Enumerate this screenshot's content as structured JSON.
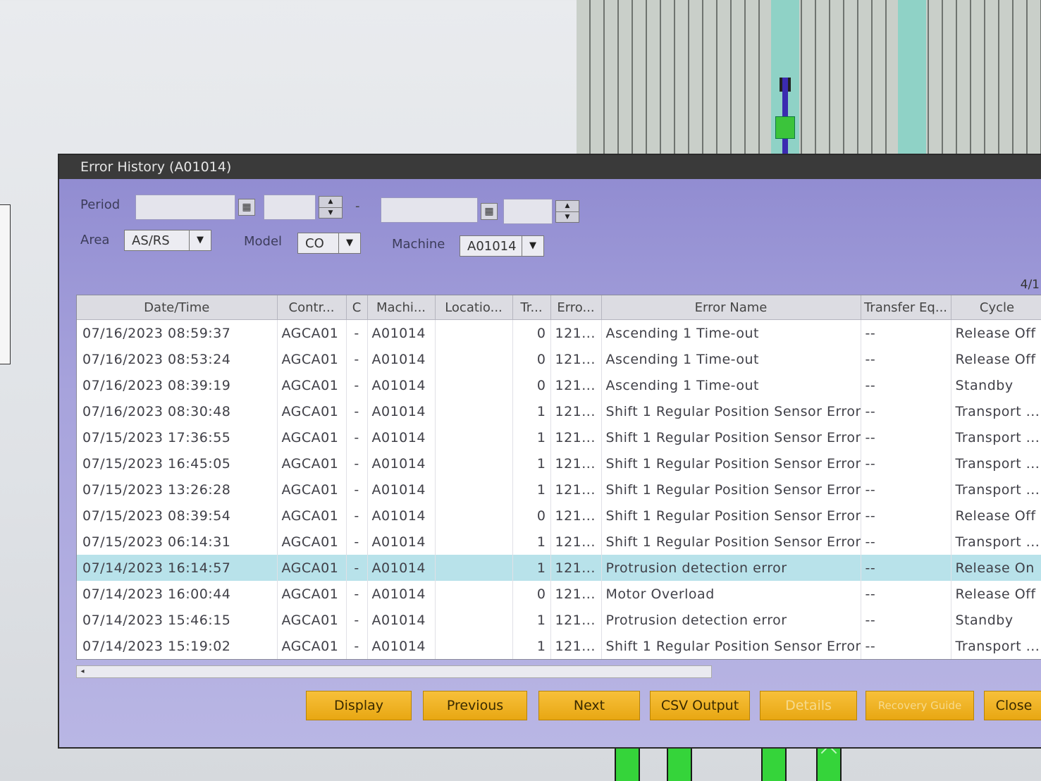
{
  "window": {
    "title": "Error History (A01014)"
  },
  "filters": {
    "period_label": "Period",
    "period_separator": "-",
    "area_label": "Area",
    "area_value": "AS/RS",
    "model_label": "Model",
    "model_value": "CO",
    "machine_label": "Machine",
    "machine_value": "A01014"
  },
  "page_indicator": "4/1",
  "table": {
    "columns": [
      "Date/Time",
      "Contr...",
      "C",
      "Machi...",
      "Locatio...",
      "Tr...",
      "Erro...",
      "Error Name",
      "Transfer Eq...",
      "Cycle"
    ],
    "rows": [
      [
        "07/16/2023 08:59:37",
        "AGCA01",
        "-",
        "A01014",
        "",
        "0",
        "121...",
        "Ascending 1 Time-out",
        "--",
        "Release Off"
      ],
      [
        "07/16/2023 08:53:24",
        "AGCA01",
        "-",
        "A01014",
        "",
        "0",
        "121...",
        "Ascending 1 Time-out",
        "--",
        "Release Off"
      ],
      [
        "07/16/2023 08:39:19",
        "AGCA01",
        "-",
        "A01014",
        "",
        "0",
        "121...",
        "Ascending 1 Time-out",
        "--",
        "Standby"
      ],
      [
        "07/16/2023 08:30:48",
        "AGCA01",
        "-",
        "A01014",
        "",
        "1",
        "121...",
        "Shift 1 Regular Position Sensor Error",
        "--",
        "Transport ..."
      ],
      [
        "07/15/2023 17:36:55",
        "AGCA01",
        "-",
        "A01014",
        "",
        "1",
        "121...",
        "Shift 1 Regular Position Sensor Error",
        "--",
        "Transport ..."
      ],
      [
        "07/15/2023 16:45:05",
        "AGCA01",
        "-",
        "A01014",
        "",
        "1",
        "121...",
        "Shift 1 Regular Position Sensor Error",
        "--",
        "Transport ..."
      ],
      [
        "07/15/2023 13:26:28",
        "AGCA01",
        "-",
        "A01014",
        "",
        "1",
        "121...",
        "Shift 1 Regular Position Sensor Error",
        "--",
        "Transport ..."
      ],
      [
        "07/15/2023 08:39:54",
        "AGCA01",
        "-",
        "A01014",
        "",
        "0",
        "121...",
        "Shift 1 Regular Position Sensor Error",
        "--",
        "Release Off"
      ],
      [
        "07/15/2023 06:14:31",
        "AGCA01",
        "-",
        "A01014",
        "",
        "1",
        "121...",
        "Shift 1 Regular Position Sensor Error",
        "--",
        "Transport ..."
      ],
      [
        "07/14/2023 16:14:57",
        "AGCA01",
        "-",
        "A01014",
        "",
        "1",
        "121...",
        "Protrusion detection error",
        "--",
        "Release On"
      ],
      [
        "07/14/2023 16:00:44",
        "AGCA01",
        "-",
        "A01014",
        "",
        "0",
        "121...",
        "Motor Overload",
        "--",
        "Release Off"
      ],
      [
        "07/14/2023 15:46:15",
        "AGCA01",
        "-",
        "A01014",
        "",
        "1",
        "121...",
        "Protrusion detection error",
        "--",
        "Standby"
      ],
      [
        "07/14/2023 15:19:02",
        "AGCA01",
        "-",
        "A01014",
        "",
        "1",
        "121...",
        "Shift 1 Regular Position Sensor Error",
        "--",
        "Transport ..."
      ]
    ],
    "selected_row": 9
  },
  "buttons": {
    "display": "Display",
    "previous": "Previous",
    "next": "Next",
    "csv_output": "CSV Output",
    "details": "Details",
    "recovery_guide": "Recovery Guide",
    "close": "Close"
  },
  "icons": {
    "calendar": "calendar-icon",
    "spin_up": "▲",
    "spin_down": "▼",
    "dropdown": "▼",
    "scroll_left": "◂"
  }
}
